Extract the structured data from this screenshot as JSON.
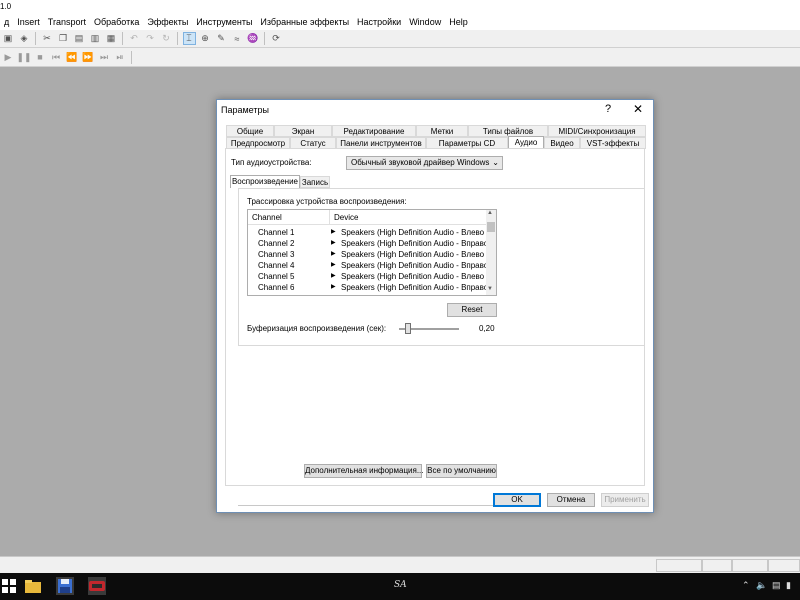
{
  "app": {
    "title_fragment": "1.0"
  },
  "menubar": {
    "items": [
      {
        "label": "д"
      },
      {
        "label": "Insert"
      },
      {
        "label": "Transport"
      },
      {
        "label": "Обработка"
      },
      {
        "label": "Эффекты"
      },
      {
        "label": "Инструменты"
      },
      {
        "label": "Избранные эффекты"
      },
      {
        "label": "Настройки"
      },
      {
        "label": "Window"
      },
      {
        "label": "Help"
      }
    ]
  },
  "toolbar1_icons": [
    "save-icon",
    "eraser-icon",
    "cut-icon",
    "copy-icon",
    "paste-icon",
    "paste-mix-icon",
    "crop-icon",
    "undo-icon",
    "redo-icon",
    "repeat-icon",
    "cursor-icon",
    "zoom-icon",
    "pencil-icon",
    "smooth-icon",
    "scrub-icon",
    "refresh-icon"
  ],
  "toolbar2_icons": [
    "play-icon",
    "pause-icon",
    "stop-icon",
    "go-start-icon",
    "rewind-icon",
    "forward-icon",
    "go-end-icon",
    "loop-icon"
  ],
  "dialog": {
    "title": "Параметры",
    "help_glyph": "?",
    "close_glyph": "✕",
    "tabs_row1": [
      {
        "label": "Общие"
      },
      {
        "label": "Экран"
      },
      {
        "label": "Редактирование"
      },
      {
        "label": "Метки"
      },
      {
        "label": "Типы файлов"
      },
      {
        "label": "MIDI/Синхронизация"
      }
    ],
    "tabs_row2": [
      {
        "label": "Предпросмотр"
      },
      {
        "label": "Статус"
      },
      {
        "label": "Панели инструментов"
      },
      {
        "label": "Параметры CD"
      },
      {
        "label": "Аудио"
      },
      {
        "label": "Видео"
      },
      {
        "label": "VST-эффекты"
      }
    ],
    "device_type_label": "Тип аудиоустройства:",
    "device_type_value": "Обычный звуковой драйвер Windows",
    "subtabs": [
      {
        "label": "Воспроизведение"
      },
      {
        "label": "Запись"
      }
    ],
    "routing_label": "Трассировка устройства воспроизведения:",
    "list_headers": {
      "channel": "Channel",
      "device": "Device"
    },
    "channels": [
      {
        "channel": "Channel 1",
        "device": "Speakers (High Definition Audio - Влево"
      },
      {
        "channel": "Channel 2",
        "device": "Speakers (High Definition Audio - Вправо"
      },
      {
        "channel": "Channel 3",
        "device": "Speakers (High Definition Audio - Влево"
      },
      {
        "channel": "Channel 4",
        "device": "Speakers (High Definition Audio - Вправо"
      },
      {
        "channel": "Channel 5",
        "device": "Speakers (High Definition Audio - Влево"
      },
      {
        "channel": "Channel 6",
        "device": "Speakers (High Definition Audio - Вправо"
      }
    ],
    "reset_label": "Reset",
    "buffer_label": "Буферизация воспроизведения (сек):",
    "buffer_value": "0,20",
    "more_info_label": "Дополнительная информация...",
    "defaults_label": "Все по умолчанию",
    "ok_label": "OK",
    "cancel_label": "Отмена",
    "apply_label": "Применить"
  },
  "taskbar": {
    "center_text": "SA",
    "icons": [
      "windows-start-icon",
      "file-explorer-icon",
      "save-app-icon",
      "sound-forge-icon"
    ],
    "tray_icons": [
      "chevron-up-icon",
      "volume-icon",
      "network-icon",
      "battery-icon"
    ]
  }
}
